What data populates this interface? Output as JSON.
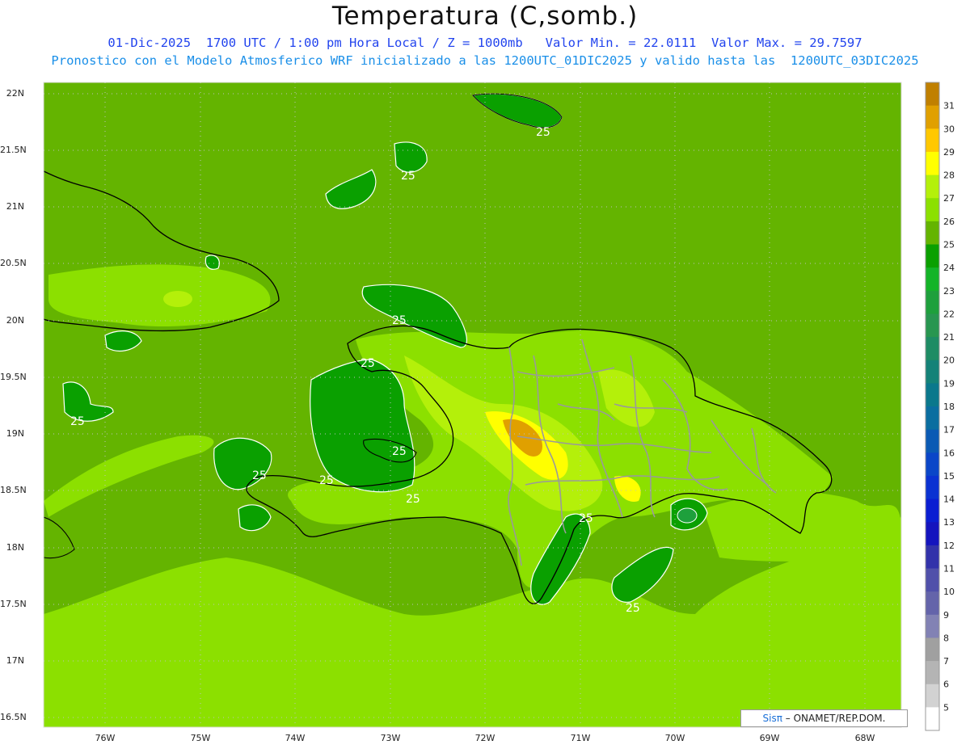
{
  "header": {
    "title": "Temperatura (C,somb.)",
    "line1": "01-Dic-2025  1700 UTC / 1:00 pm Hora Local / Z = 1000mb   Valor Min. = 22.0111  Valor Max. = 29.7597",
    "line2": "Pronostico con el Modelo Atmosferico WRF inicializado a las 1200UTC_01DIC2025 y valido hasta las  1200UTC_03DIC2025"
  },
  "axes": {
    "lat_labels": [
      "22N",
      "21.5N",
      "21N",
      "20.5N",
      "20N",
      "19.5N",
      "19N",
      "18.5N",
      "18N",
      "17.5N",
      "17N",
      "16.5N"
    ],
    "lon_labels": [
      "76W",
      "75W",
      "74W",
      "73W",
      "72W",
      "71W",
      "70W",
      "69W",
      "68W"
    ]
  },
  "contour_labels": [
    "25",
    "25",
    "25",
    "25",
    "25",
    "25",
    "25",
    "25",
    "25",
    "25",
    "25"
  ],
  "colorbar": {
    "labels": [
      "31",
      "30",
      "29",
      "28",
      "27",
      "26",
      "25",
      "24",
      "23",
      "22",
      "21",
      "20",
      "19",
      "18",
      "17",
      "16",
      "15",
      "14",
      "13",
      "12",
      "11",
      "10",
      "9",
      "8",
      "7",
      "6",
      "5"
    ],
    "colors": [
      "#c08000",
      "#e0a000",
      "#ffc800",
      "#ffff00",
      "#b4f00a",
      "#8ce000",
      "#64b400",
      "#0aa000",
      "#14b428",
      "#1ea03c",
      "#289650",
      "#1e8c64",
      "#148278",
      "#0a788c",
      "#0a6ea0",
      "#0a5ab4",
      "#0a46c8",
      "#0a32d2",
      "#0a1ed2",
      "#1414be",
      "#3232aa",
      "#5050aa",
      "#6464aa",
      "#8282b4",
      "#a0a0a0",
      "#b4b4b4",
      "#d2d2d2",
      "#ffffff"
    ]
  },
  "credit": {
    "brand": "Sisπ",
    "rest": " – ONAMET/REP.DOM."
  }
}
